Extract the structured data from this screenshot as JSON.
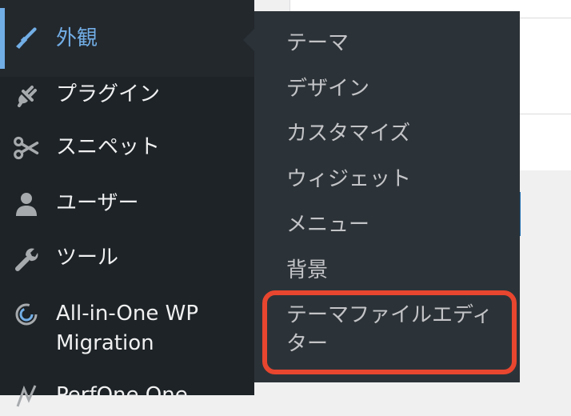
{
  "sidebar": {
    "items": [
      {
        "label": "外観",
        "icon": "paintbrush-icon",
        "current": true
      },
      {
        "label": "プラグイン",
        "icon": "plug-icon"
      },
      {
        "label": "スニペット",
        "icon": "scissors-icon"
      },
      {
        "label": "ユーザー",
        "icon": "user-icon"
      },
      {
        "label": "ツール",
        "icon": "wrench-icon"
      },
      {
        "label": "All-in-One WP",
        "label2": "Migration",
        "icon": "migration-icon"
      },
      {
        "label": "PerfOne One",
        "icon": "chart-icon"
      }
    ]
  },
  "submenu": {
    "items": [
      {
        "label": "テーマ"
      },
      {
        "label": "デザイン"
      },
      {
        "label": "カスタマイズ"
      },
      {
        "label": "ウィジェット"
      },
      {
        "label": "メニュー"
      },
      {
        "label": "背景"
      },
      {
        "label": "テーマファイルエディ",
        "label2": "ター"
      }
    ]
  },
  "colors": {
    "sidebar_bg": "#1d2327",
    "submenu_bg": "#2c3338",
    "accent": "#72aee6",
    "highlight": "#e8462f"
  }
}
